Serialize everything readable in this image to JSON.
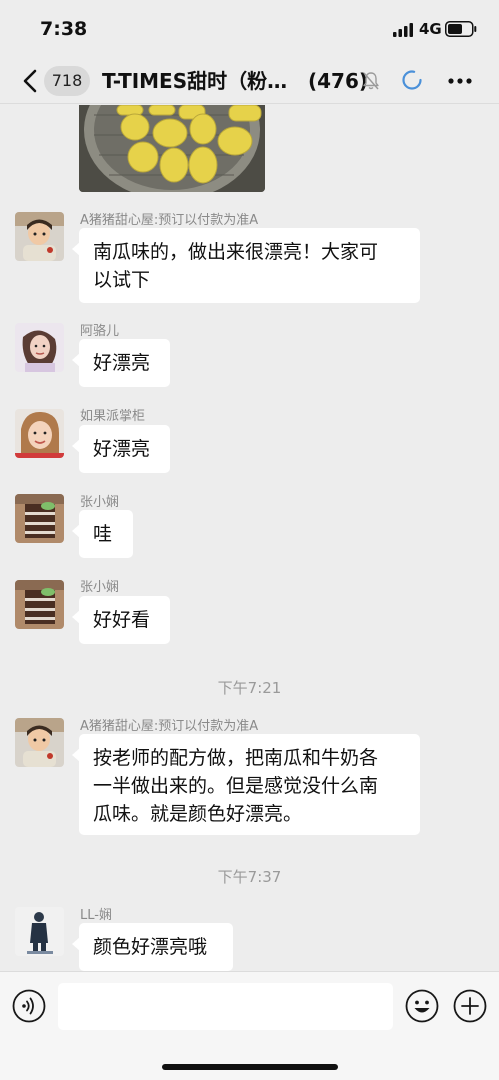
{
  "status_bar": {
    "time": "7:38",
    "network": "4G"
  },
  "nav": {
    "unread_count": "718",
    "title": "T-TIMES甜时（粉…",
    "member_count": "(476)"
  },
  "messages": [
    {
      "sender": "A猪猪甜心屋:预订以付款为准A",
      "lines": [
        "南瓜味的，做出来很漂亮！大家可",
        "以试下"
      ]
    },
    {
      "sender": "阿骆儿",
      "lines": [
        "好漂亮"
      ]
    },
    {
      "sender": "如果派掌柜",
      "lines": [
        "好漂亮"
      ]
    },
    {
      "sender": "张小娴",
      "lines": [
        "哇"
      ]
    },
    {
      "sender": "张小娴",
      "lines": [
        "好好看"
      ]
    },
    {
      "sender": "A猪猪甜心屋:预订以付款为准A",
      "lines": [
        "按老师的配方做，把南瓜和牛奶各",
        "一半做出来的。但是感觉没什么南",
        "瓜味。就是颜色好漂亮。"
      ]
    },
    {
      "sender": "LL-娴",
      "lines": [
        "颜色好漂亮哦"
      ]
    }
  ],
  "timestamps": [
    "下午7:21",
    "下午7:37"
  ],
  "icons": {
    "back": "chevron-left-icon",
    "mute": "bell-muted-icon",
    "loading": "loading-spinner-icon",
    "more": "more-dots-icon",
    "voice": "voice-icon",
    "emoji": "emoji-icon",
    "plus": "plus-icon"
  },
  "colors": {
    "background": "#ededed",
    "bubble": "#ffffff",
    "accent_spinner": "#4a90d9"
  }
}
